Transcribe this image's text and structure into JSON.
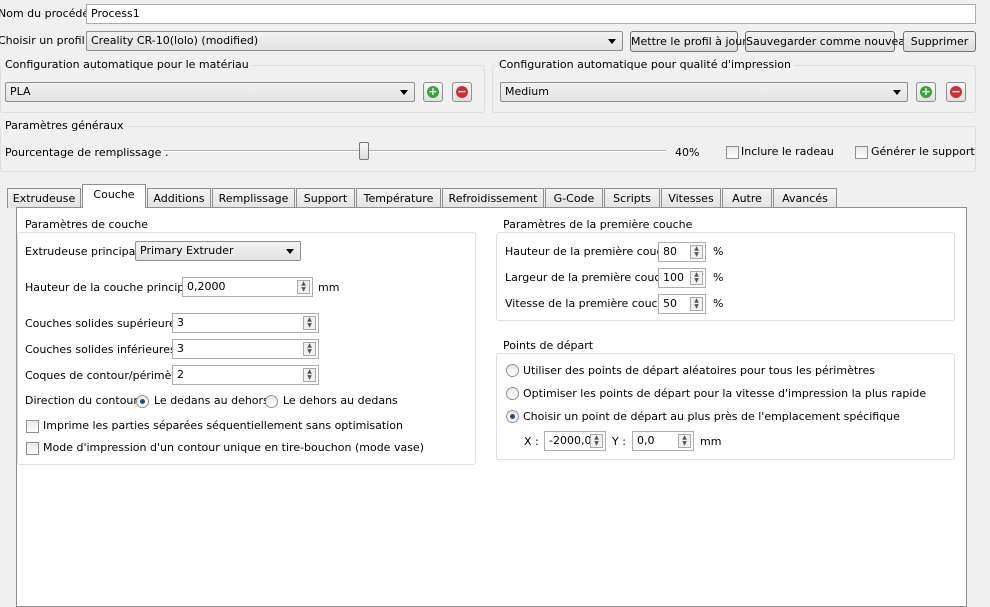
{
  "process": {
    "label": "Nom du procédé :",
    "value": "Process1"
  },
  "profile": {
    "label": "Choisir un profil :",
    "value": "Creality CR-10(lolo) (modified)",
    "update_button": "Mettre le profil à jour",
    "save_new_button": "Sauvegarder comme nouveau",
    "delete_button": "Supprimer"
  },
  "material": {
    "title": "Configuration automatique pour le matériau",
    "value": "PLA"
  },
  "quality": {
    "title": "Configuration automatique pour qualité d'impression",
    "value": "Medium"
  },
  "general": {
    "title": "Paramètres généraux",
    "infill_label": "Pourcentage de remplissage :",
    "infill_value": "40%",
    "infill_percent": 40,
    "raft_label": "Inclure le radeau",
    "raft_checked": false,
    "support_label": "Générer le support",
    "support_checked": false
  },
  "tabs": [
    "Extrudeuse",
    "Couche",
    "Additions",
    "Remplissage",
    "Support",
    "Température",
    "Refroidissement",
    "G-Code",
    "Scripts",
    "Vitesses",
    "Autre",
    "Avancés"
  ],
  "active_tab": "Couche",
  "layer": {
    "title": "Paramètres de couche",
    "extruder_label": "Extrudeuse principale",
    "extruder_value": "Primary Extruder",
    "height_label": "Hauteur de la couche principale",
    "height_value": "0,2000",
    "height_unit": "mm",
    "top_label": "Couches solides supérieures",
    "top_value": "3",
    "bottom_label": "Couches solides inférieures",
    "bottom_value": "3",
    "shells_label": "Coques de contour/périmètre",
    "shells_value": "2",
    "direction_label": "Direction du contour :",
    "direction_in_out": "Le dedans au dehors",
    "direction_out_in": "Le dehors au dedans",
    "sequential_label": "Imprime les parties séparées séquentiellement sans optimisation",
    "vase_label": "Mode d'impression d'un contour unique en tire-bouchon (mode vase)"
  },
  "first_layer": {
    "title": "Paramètres de la première couche",
    "height_label": "Hauteur de la première couche",
    "height_value": "80",
    "width_label": "Largeur de la première couche",
    "width_value": "100",
    "speed_label": "Vitesse de la première couche",
    "speed_value": "50",
    "unit": "%"
  },
  "start_points": {
    "title": "Points de départ",
    "random_label": "Utiliser des points de départ aléatoires pour tous les périmètres",
    "optimize_label": "Optimiser les points de départ pour la vitesse d'impression la plus rapide",
    "nearest_label": "Choisir un point de départ au plus près de l'emplacement spécifique",
    "x_label": "X :",
    "x_value": "-2000,0",
    "y_label": "Y :",
    "y_value": "0,0",
    "unit": "mm"
  }
}
